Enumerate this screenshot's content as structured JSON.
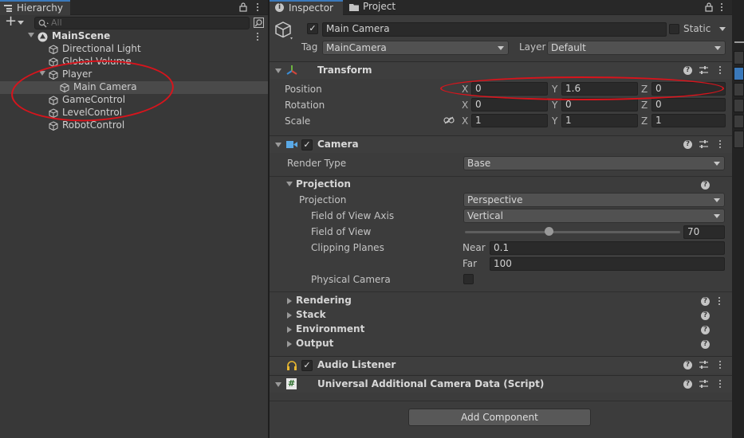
{
  "hierarchy": {
    "tab": "Hierarchy",
    "add_label": "+",
    "search_placeholder": "All",
    "items": [
      {
        "label": "MainScene"
      },
      {
        "label": "Directional Light"
      },
      {
        "label": "Global Volume"
      },
      {
        "label": "Player"
      },
      {
        "label": "Main Camera"
      },
      {
        "label": "GameControl"
      },
      {
        "label": "LevelControl"
      },
      {
        "label": "RobotControl"
      }
    ]
  },
  "inspector": {
    "tabs": [
      {
        "label": "Inspector"
      },
      {
        "label": "Project"
      }
    ],
    "object": {
      "name": "Main Camera",
      "active": true,
      "static_label": "Static",
      "tag_label": "Tag",
      "tag_value": "MainCamera",
      "layer_label": "Layer",
      "layer_value": "Default"
    },
    "transform": {
      "title": "Transform",
      "rows": [
        {
          "label": "Position",
          "x": "0",
          "y": "1.6",
          "z": "0"
        },
        {
          "label": "Rotation",
          "x": "0",
          "y": "0",
          "z": "0"
        },
        {
          "label": "Scale",
          "x": "1",
          "y": "1",
          "z": "1"
        }
      ],
      "axis_x": "X",
      "axis_y": "Y",
      "axis_z": "Z"
    },
    "camera": {
      "title": "Camera",
      "render_type_label": "Render Type",
      "render_type_value": "Base",
      "projection_section": "Projection",
      "projection_label": "Projection",
      "projection_value": "Perspective",
      "fov_axis_label": "Field of View Axis",
      "fov_axis_value": "Vertical",
      "fov_label": "Field of View",
      "fov_value": "70",
      "fov_min": 1,
      "fov_max": 179,
      "clipping_label": "Clipping Planes",
      "near_label": "Near",
      "near_value": "0.1",
      "far_label": "Far",
      "far_value": "100",
      "physical_label": "Physical Camera",
      "sections": [
        {
          "label": "Rendering"
        },
        {
          "label": "Stack"
        },
        {
          "label": "Environment"
        },
        {
          "label": "Output"
        }
      ]
    },
    "audio_listener": {
      "title": "Audio Listener"
    },
    "additional_data": {
      "title": "Universal Additional Camera Data (Script)"
    },
    "add_component": "Add Component"
  },
  "colors": {
    "accent": "#3a79bb",
    "annotation": "#d8141c"
  }
}
